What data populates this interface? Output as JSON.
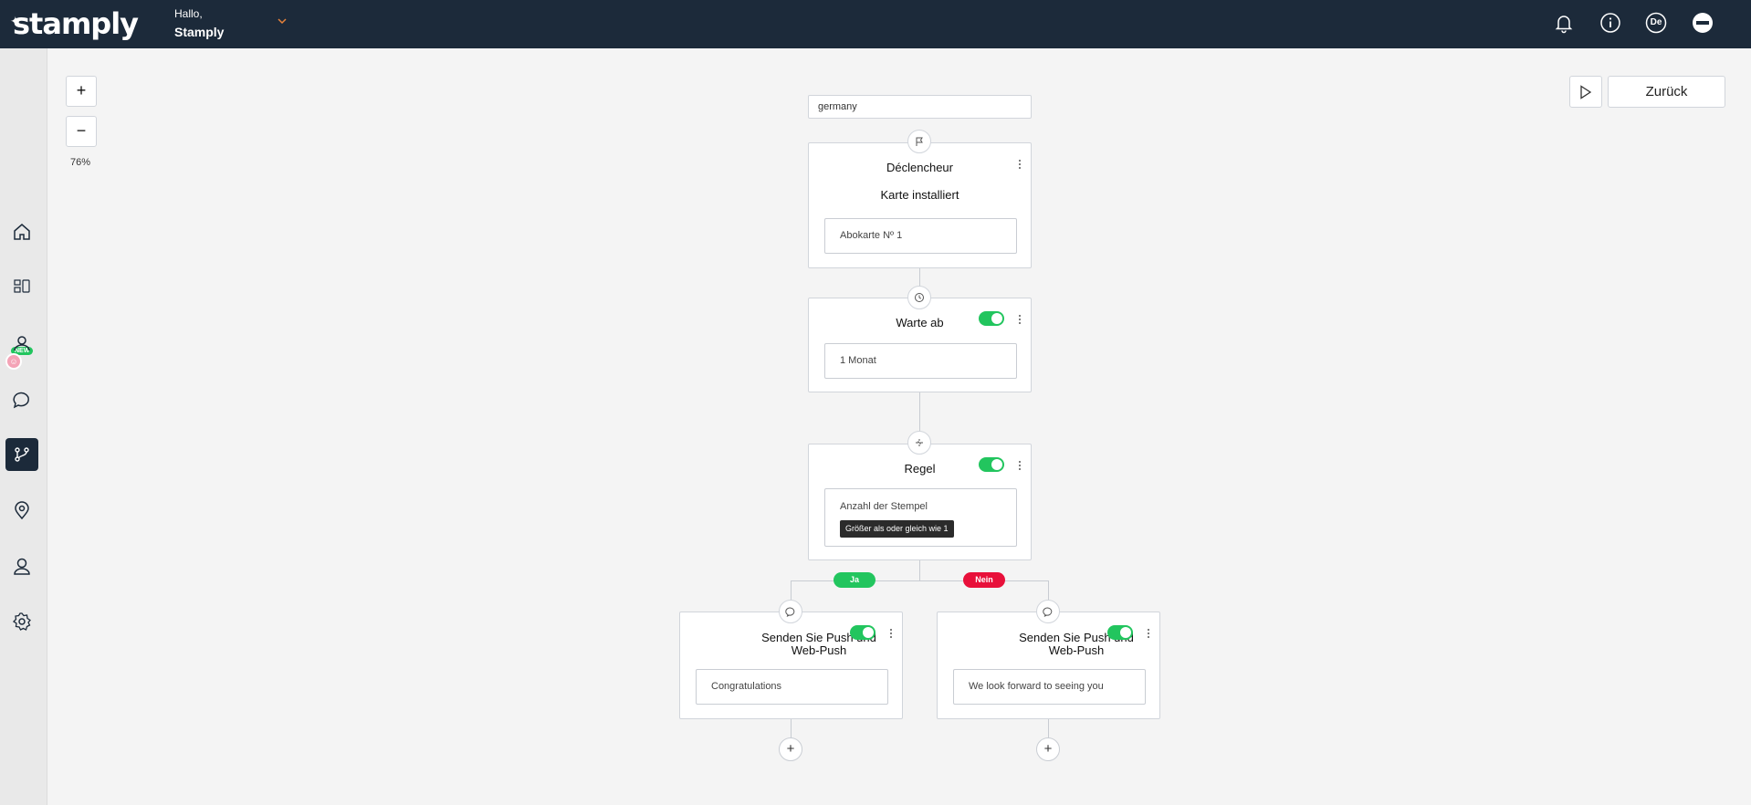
{
  "header": {
    "logo": "stamply",
    "greeting": "Hallo,",
    "account_name": "Stamply",
    "language": "De",
    "icons": [
      "bell-icon",
      "info-icon",
      "language-icon",
      "avatar-icon"
    ]
  },
  "sidebar": {
    "items": [
      {
        "name": "home-icon"
      },
      {
        "name": "cards-icon",
        "badge": "NEW"
      },
      {
        "name": "customers-icon"
      },
      {
        "name": "messages-icon"
      },
      {
        "name": "automation-icon",
        "active": true
      },
      {
        "name": "location-icon"
      },
      {
        "name": "user-icon"
      },
      {
        "name": "settings-icon"
      }
    ]
  },
  "canvas": {
    "zoom_in": "+",
    "zoom_out": "−",
    "zoom_level": "76%",
    "back_label": "Zurück"
  },
  "flow": {
    "name": "germany",
    "trigger": {
      "title": "Déclencheur",
      "subtitle": "Karte installiert",
      "value": "Abokarte Nº 1"
    },
    "wait": {
      "title": "Warte ab",
      "value": "1 Monat",
      "enabled": true
    },
    "rule": {
      "title": "Regel",
      "field": "Anzahl der Stempel",
      "condition": "Größer als oder gleich wie 1",
      "enabled": true
    },
    "branches": {
      "yes_label": "Ja",
      "no_label": "Nein",
      "yes_color": "#22c55e",
      "no_color": "#e8103a"
    },
    "push_yes": {
      "title_line1": "Senden Sie Push und",
      "title_line2": "Web-Push",
      "message": "Congratulations",
      "enabled": true
    },
    "push_no": {
      "title_line1": "Senden Sie Push und",
      "title_line2": "Web-Push",
      "message": "We look forward to seeing you",
      "enabled": true
    },
    "add_label": "+"
  },
  "colors": {
    "header_bg": "#1c2a3a",
    "toggle_on": "#22c55e",
    "accent": "#e8833a"
  }
}
